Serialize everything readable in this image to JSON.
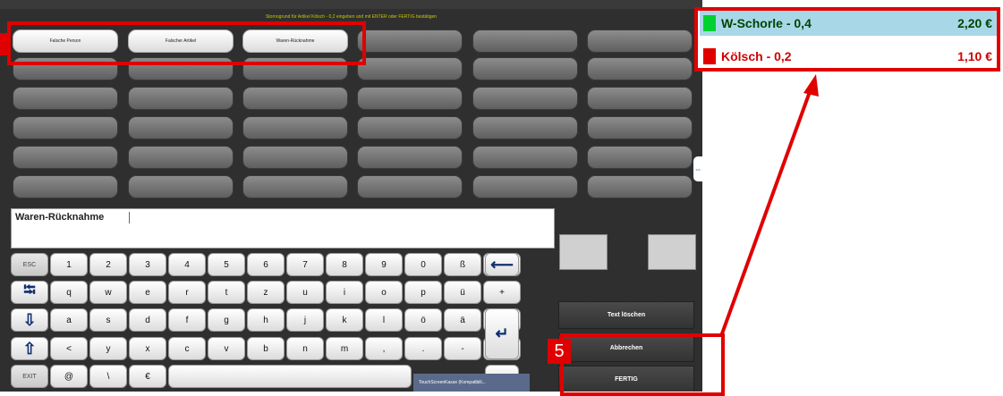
{
  "pos": {
    "instruction": "Stornogrund für Artikel Kölsch - 0,2 eingeben und mit ENTER oder FERTIG bestätigen",
    "reason_buttons": [
      "Falsche Person",
      "Falscher Artikel",
      "Waren-Rücknahme"
    ],
    "textfield_value": "Waren-Rücknahme",
    "keyboard": {
      "row1": [
        "ESC",
        "1",
        "2",
        "3",
        "4",
        "5",
        "6",
        "7",
        "8",
        "9",
        "0",
        "ß",
        "´"
      ],
      "row2": [
        "q",
        "w",
        "e",
        "r",
        "t",
        "z",
        "u",
        "i",
        "o",
        "p",
        "ü",
        "+",
        "DEL"
      ],
      "row3": [
        "a",
        "s",
        "d",
        "f",
        "g",
        "h",
        "j",
        "k",
        "l",
        "ö",
        "ä",
        "#"
      ],
      "row4": [
        "<",
        "y",
        "x",
        "c",
        "v",
        "b",
        "n",
        "m",
        ",",
        ".",
        "-",
        "^"
      ],
      "row5": [
        "EXIT",
        "@",
        "\\",
        "€"
      ]
    },
    "actions": {
      "clear": "Text löschen",
      "cancel": "Abbrechen",
      "done": "FERTIG"
    },
    "taskbar_label": "TouchScreenKasse (Kompatibili..."
  },
  "cart": {
    "items": [
      {
        "name": "W-Schorle - 0,4",
        "price": "2,20 €",
        "color": "#00d030",
        "text_color": "#004400",
        "bg": "#a8d8e8"
      },
      {
        "name": "Kölsch - 0,2",
        "price": "1,10 €",
        "color": "#e00000",
        "text_color": "#d00000",
        "bg": "#ffffff"
      }
    ]
  },
  "annotation": {
    "callout_number": "5",
    "accent_color": "#e00000"
  }
}
